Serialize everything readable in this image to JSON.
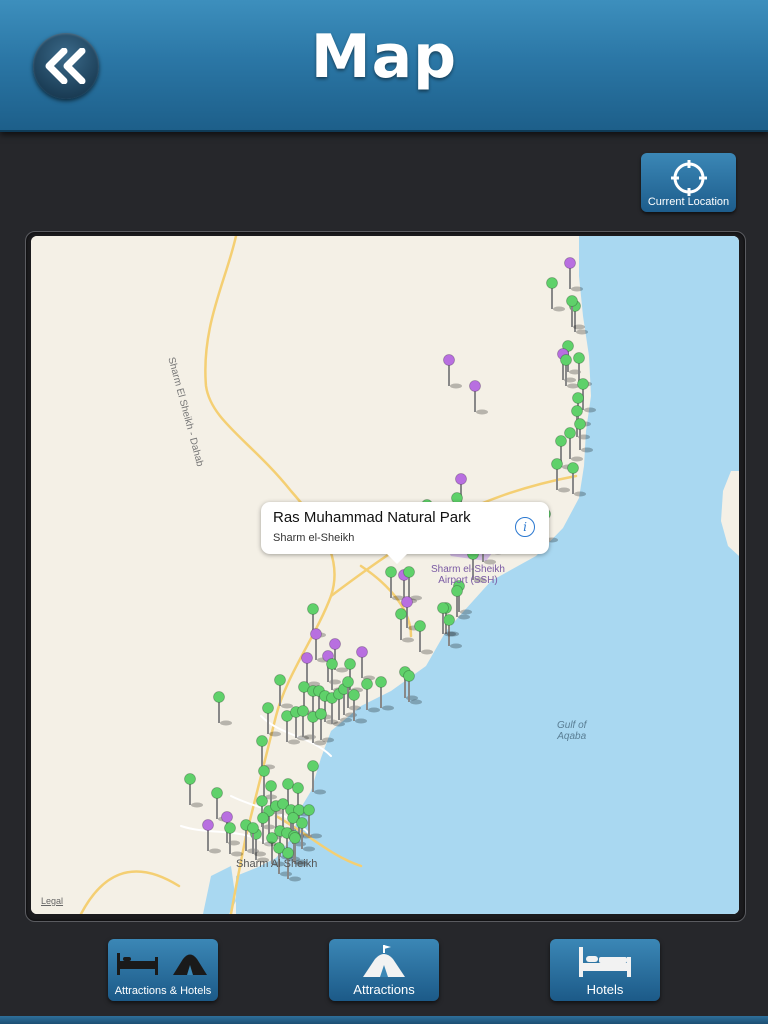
{
  "header": {
    "title": "Map",
    "back_icon": "double-chevron-left-icon"
  },
  "toolbar": {
    "current_location_label": "Current Location",
    "current_location_icon": "crosshair-icon"
  },
  "map": {
    "road_label": "Sharm El Sheikh - Dahab",
    "airport_label_line1": "Sharm el-Sheikh",
    "airport_label_line2": "Airport (SSH)",
    "gulf_label_line1": "Gulf of",
    "gulf_label_line2": "Aqaba",
    "city_label": "Sharm Al Sheikh",
    "legal_label": "Legal",
    "pin_colors": {
      "attraction": "#5fd16a",
      "hotel": "#b86fe0"
    }
  },
  "callout": {
    "title": "Ras Muhammad Natural Park",
    "subtitle": "Sharm el-Sheikh",
    "info_icon": "info-icon"
  },
  "tabs": [
    {
      "label": "Attractions & Hotels",
      "icon": "bed-and-tent-icon"
    },
    {
      "label": "Attractions",
      "icon": "tent-icon"
    },
    {
      "label": "Hotels",
      "icon": "bed-icon"
    }
  ]
}
